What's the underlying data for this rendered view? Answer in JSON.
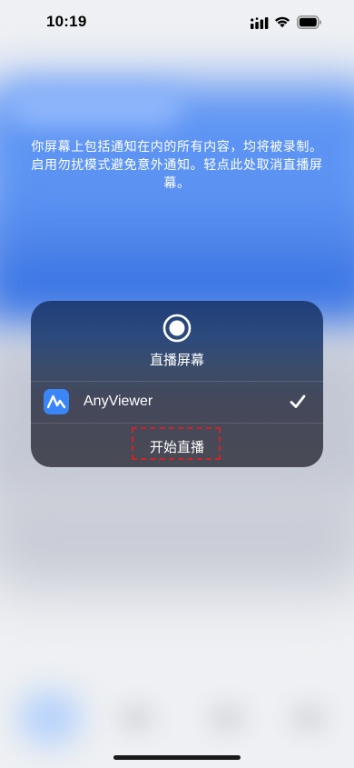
{
  "status_bar": {
    "time": "10:19",
    "icons": [
      "signal-icon",
      "wifi-icon",
      "battery-icon"
    ]
  },
  "info_text": "你屏幕上包括通知在内的所有内容，均将被录制。启用勿扰模式避免意外通知。轻点此处取消直播屏幕。",
  "broadcast_panel": {
    "icon": "record-icon",
    "title": "直播屏幕",
    "app": {
      "icon": "anyviewer-app-icon",
      "name": "AnyViewer",
      "selected": true
    },
    "start_button_label": "开始直播"
  },
  "colors": {
    "accent_blue": "#3a86f6",
    "highlight_red": "#d0232a"
  }
}
